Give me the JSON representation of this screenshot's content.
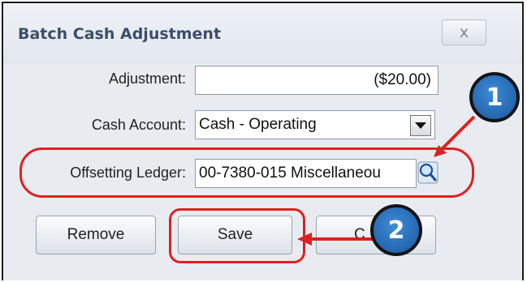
{
  "dialog": {
    "title": "Batch Cash Adjustment",
    "close_label": "x"
  },
  "fields": {
    "adjustment_label": "Adjustment:",
    "adjustment_value": "($20.00)",
    "cash_account_label": "Cash Account:",
    "cash_account_value": "Cash - Operating",
    "offsetting_ledger_label": "Offsetting Ledger:",
    "offsetting_ledger_value": "00-7380-015 Miscellaneou"
  },
  "buttons": {
    "remove": "Remove",
    "save": "Save",
    "cancel_partial": "C"
  },
  "callouts": {
    "one": "1",
    "two": "2"
  },
  "colors": {
    "annotation_red": "#e02020",
    "callout_blue": "#1a56a0",
    "title_text": "#3b4e6a"
  },
  "icons": {
    "lookup": "magnifier-icon",
    "dropdown": "chevron-down-icon",
    "close": "close-icon"
  }
}
